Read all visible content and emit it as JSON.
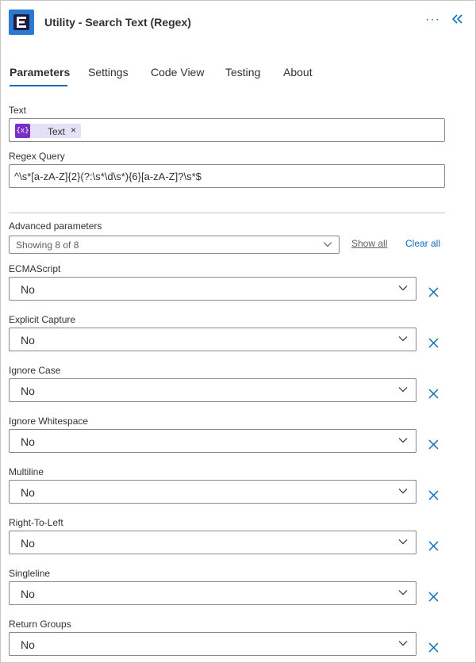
{
  "header": {
    "title": "Utility - Search Text (Regex)",
    "logo_color": "#2b78d3",
    "more_icon": "more-icon",
    "collapse_icon": "collapse-icon"
  },
  "tabs": [
    {
      "label": "Parameters",
      "active": true
    },
    {
      "label": "Settings",
      "active": false
    },
    {
      "label": "Code View",
      "active": false
    },
    {
      "label": "Testing",
      "active": false
    },
    {
      "label": "About",
      "active": false
    }
  ],
  "text_field": {
    "label": "Text",
    "token_icon": "{x}",
    "token_label": "Text",
    "token_remove": "×"
  },
  "regex_field": {
    "label": "Regex Query",
    "value": "^\\s*[a-zA-Z]{2}(?:\\s*\\d\\s*){6}[a-zA-Z]?\\s*$"
  },
  "advanced": {
    "label": "Advanced parameters",
    "selected": "Showing 8 of 8",
    "show_all": "Show all",
    "clear_all": "Clear all"
  },
  "params": [
    {
      "label": "ECMAScript",
      "value": "No"
    },
    {
      "label": "Explicit Capture",
      "value": "No"
    },
    {
      "label": "Ignore Case",
      "value": "No"
    },
    {
      "label": "Ignore Whitespace",
      "value": "No"
    },
    {
      "label": "Multiline",
      "value": "No"
    },
    {
      "label": "Right-To-Left",
      "value": "No"
    },
    {
      "label": "Singleline",
      "value": "No"
    },
    {
      "label": "Return Groups",
      "value": "No"
    }
  ],
  "colors": {
    "accent": "#0f6cbd",
    "token_bg": "#e6e0f7",
    "token_icon_bg": "#7a2ec8",
    "border": "#8a8886"
  }
}
